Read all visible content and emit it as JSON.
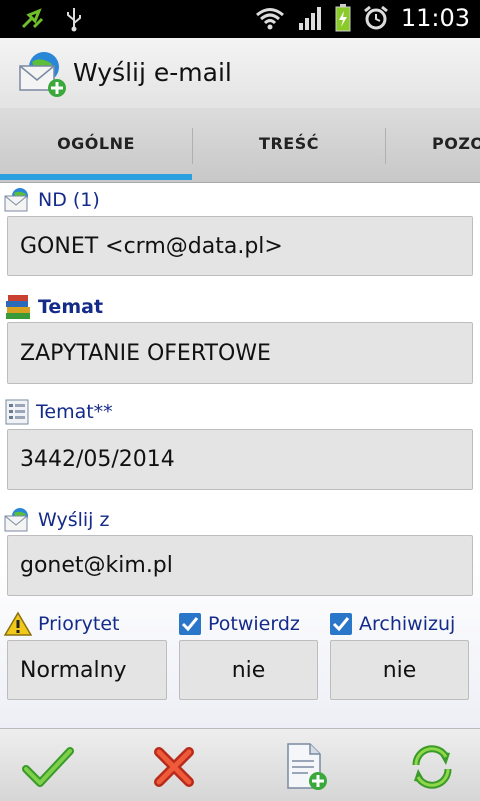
{
  "status_bar": {
    "time": "11:03",
    "icons": [
      "sync-icon",
      "usb-icon",
      "wifi-icon",
      "signal-icon",
      "battery-charging-icon",
      "alarm-icon"
    ]
  },
  "title_bar": {
    "title": "Wyślij e-mail",
    "icon": "email-add-icon"
  },
  "tabs": [
    {
      "label": "OGÓLNE",
      "selected": true
    },
    {
      "label": "TREŚĆ",
      "selected": false
    },
    {
      "label": "POZO",
      "selected": false
    }
  ],
  "accent_color": "#2aa0e0",
  "form": {
    "to": {
      "label": "ND (1)",
      "value": "GONET <crm@data.pl>",
      "icon": "email-icon"
    },
    "subject": {
      "label": "Temat",
      "value": "ZAPYTANIE OFERTOWE",
      "icon": "books-icon"
    },
    "subject2": {
      "label": "Temat**",
      "value": "3442/05/2014",
      "icon": "document-list-icon"
    },
    "from": {
      "label": "Wyślij z",
      "value": "gonet@kim.pl",
      "icon": "email-icon"
    },
    "priority": {
      "label": "Priorytet",
      "value": "Normalny",
      "icon": "warning-icon"
    },
    "confirm": {
      "label": "Potwierdz",
      "value": "nie",
      "checked": true
    },
    "archive": {
      "label": "Archiwizuj",
      "value": "nie",
      "checked": true
    }
  },
  "bottom_bar": {
    "buttons": [
      "confirm-check-icon",
      "cancel-x-icon",
      "new-document-icon",
      "refresh-icon"
    ]
  }
}
